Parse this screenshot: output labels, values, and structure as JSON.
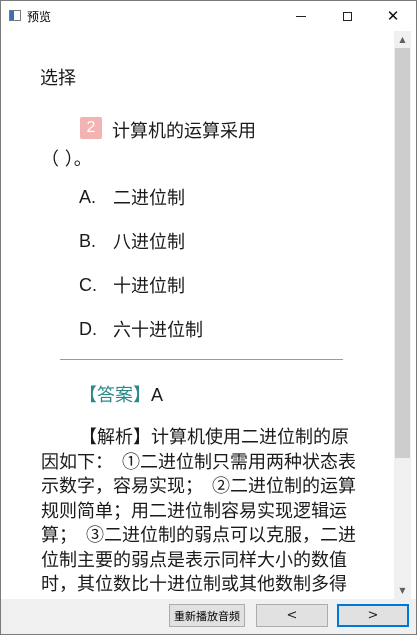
{
  "window": {
    "title": "预览",
    "min_glyph": "",
    "max_glyph": "",
    "close_glyph": "✕"
  },
  "content": {
    "section_title": "选择",
    "question": {
      "number": "2",
      "text": "计算机的运算采用",
      "paren": "（      ）。"
    },
    "options": [
      {
        "letter": "A.",
        "text": "二进位制"
      },
      {
        "letter": "B.",
        "text": "八进位制"
      },
      {
        "letter": "C.",
        "text": "十进位制"
      },
      {
        "letter": "D.",
        "text": "六十进位制"
      }
    ],
    "answer": {
      "label": "【答案】",
      "value": "A"
    },
    "analysis": "【解析】计算机使用二进位制的原因如下：　①二进位制只需用两种状态表示数字，容易实现；　②二进位制的运算规则简单；用二进位制容易实现逻辑运算；　③二进位制的弱点可以克服，二进位制主要的弱点是表示同样大小的数值时，其位数比十进位制或其他数制多得多，难以书写和记忆。"
  },
  "bottom_bar": {
    "replay_label": "重新播放音频",
    "prev_label": "<",
    "next_label": ">"
  },
  "scrollbar": {
    "up_glyph": "▲",
    "down_glyph": "▼"
  }
}
